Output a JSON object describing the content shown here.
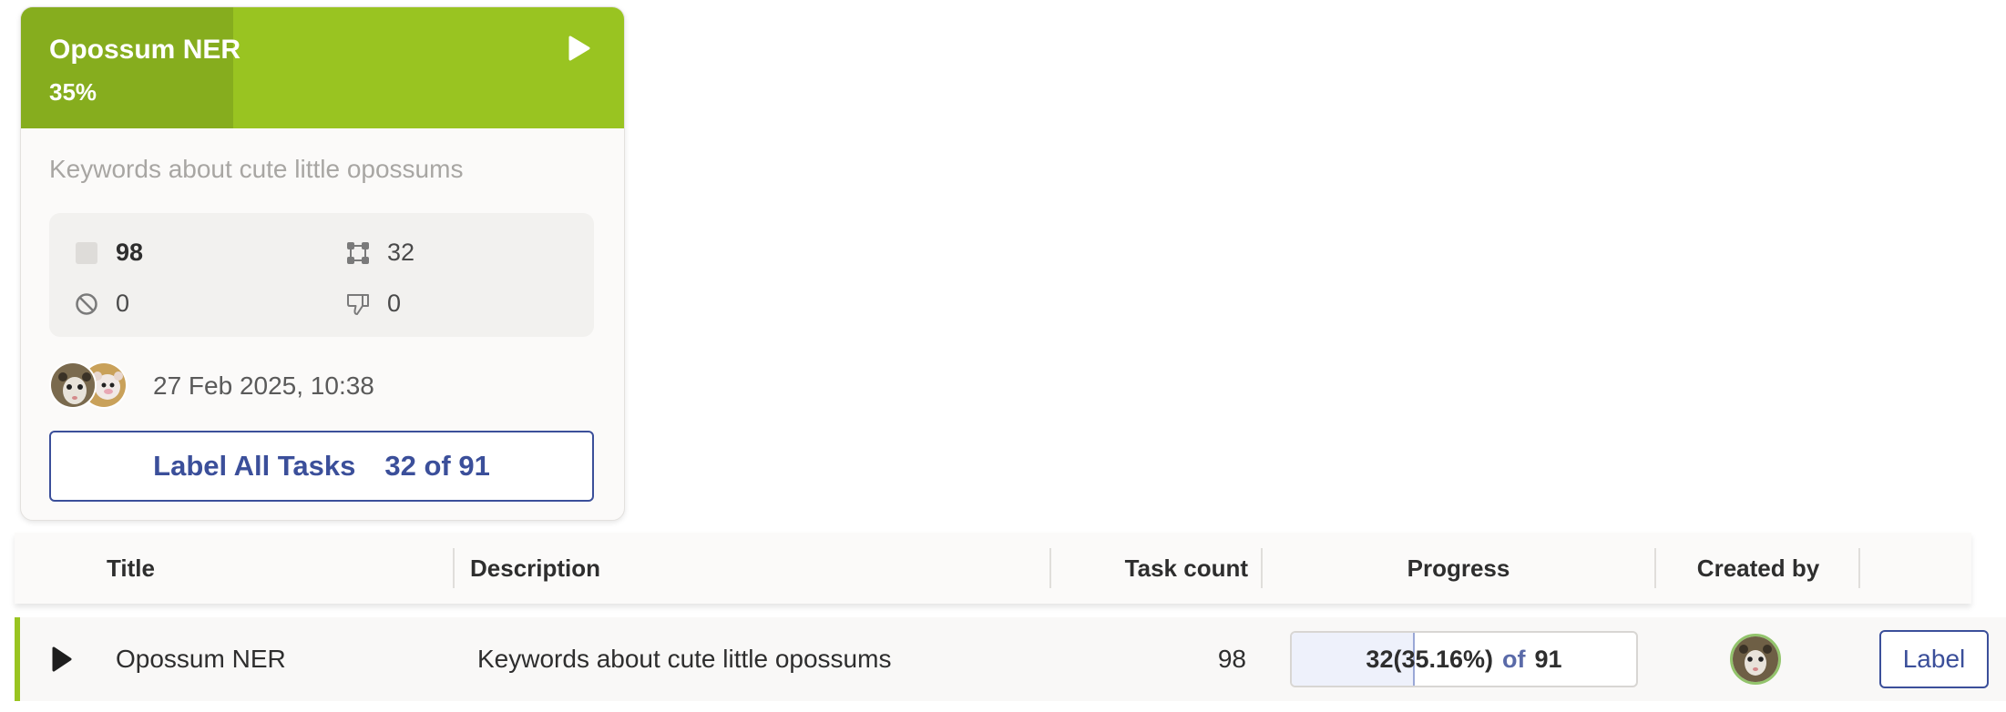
{
  "card": {
    "title": "Opossum NER",
    "percent_label": "35%",
    "progress_fraction": 0.3516,
    "description": "Keywords about cute little opossums",
    "stats": {
      "tasks": "98",
      "annotated": "32",
      "skipped": "0",
      "rejected": "0"
    },
    "date": "27 Feb 2025, 10:38",
    "label_button": {
      "label": "Label All Tasks",
      "count": "32 of 91"
    },
    "colors": {
      "header": "#99c421",
      "header_progress": "#86ad1e",
      "accent": "#3b4f9a"
    },
    "icons": {
      "play": "play-icon",
      "tasks": "task-square-icon",
      "annotated": "annotation-region-icon",
      "skipped": "skip-icon",
      "rejected": "thumbs-down-icon"
    }
  },
  "table": {
    "headers": {
      "title": "Title",
      "description": "Description",
      "task_count": "Task count",
      "progress": "Progress",
      "created_by": "Created by"
    },
    "rows": [
      {
        "title": "Opossum NER",
        "description": "Keywords about cute little opossums",
        "task_count": "98",
        "progress": {
          "done": "32",
          "pct": "(35.16%)",
          "of": "of",
          "total": "91",
          "fraction": 0.3516
        },
        "action": "Label"
      }
    ]
  }
}
